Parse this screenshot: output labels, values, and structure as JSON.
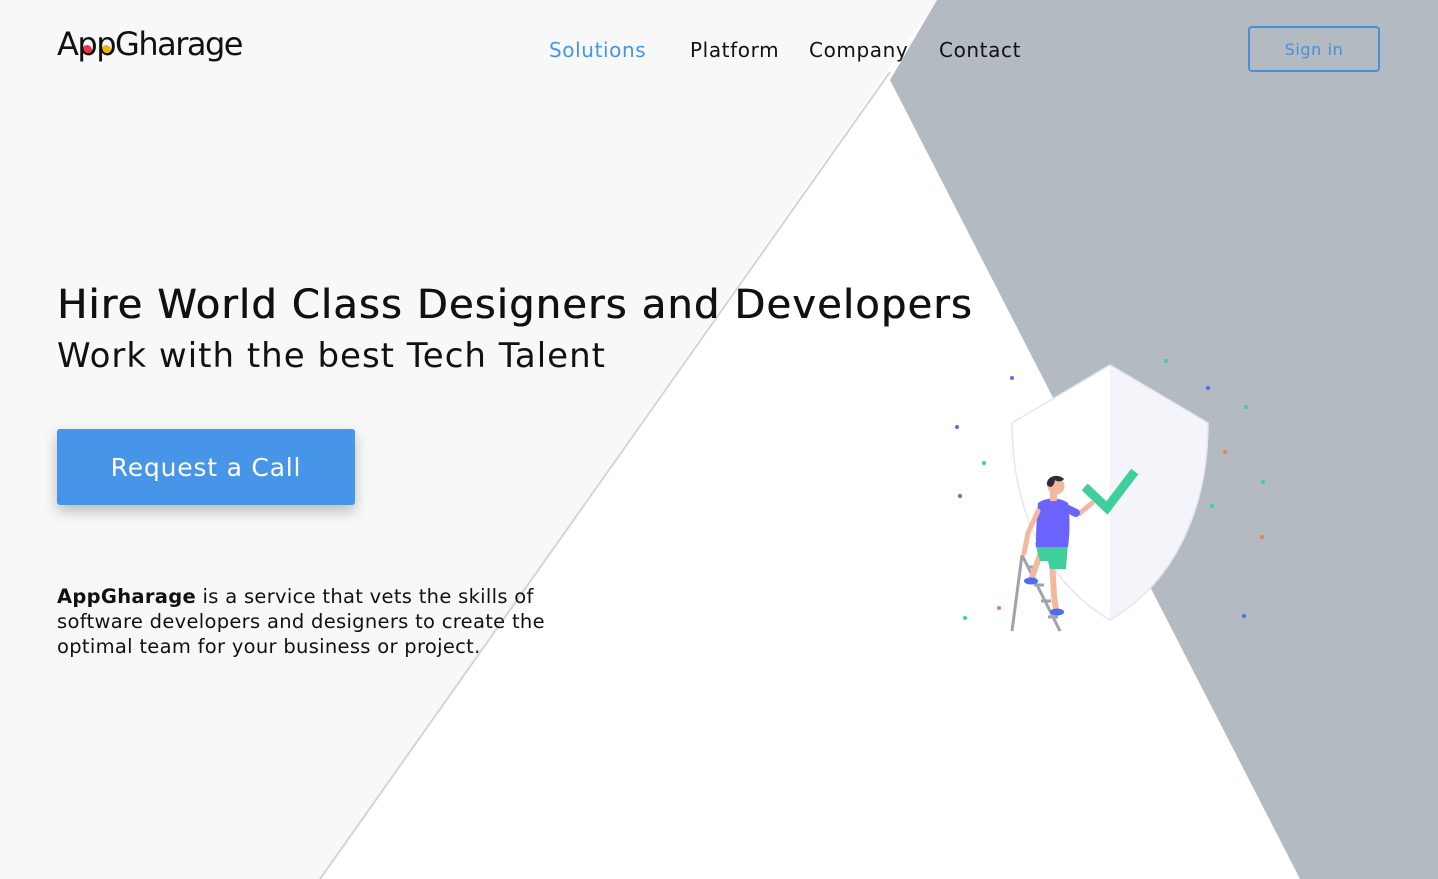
{
  "header": {
    "logo_text": "AppGharage",
    "nav": [
      {
        "label": "Solutions",
        "active": true
      },
      {
        "label": "Platform",
        "active": false
      },
      {
        "label": "Company",
        "active": false
      },
      {
        "label": "Contact",
        "active": false
      }
    ],
    "signin_label": "Sign in"
  },
  "hero": {
    "title": "Hire World Class Designers and Developers",
    "subtitle": "Work with the best Tech Talent",
    "cta_label": "Request a Call",
    "description_brand": "AppGharage",
    "description_rest": " is a service that vets the skills of software developers and designers to create the optimal team for your business or project."
  },
  "illustration": {
    "icon": "shield-check-person-illustration"
  },
  "colors": {
    "accent": "#4795e8",
    "signin_border": "#4a8fd8",
    "left_panel": "#f8f8f8",
    "right_panel": "#b3bac2",
    "check": "#3ecf9a",
    "shirt": "#6c63ff",
    "shorts": "#3ecf9a"
  }
}
